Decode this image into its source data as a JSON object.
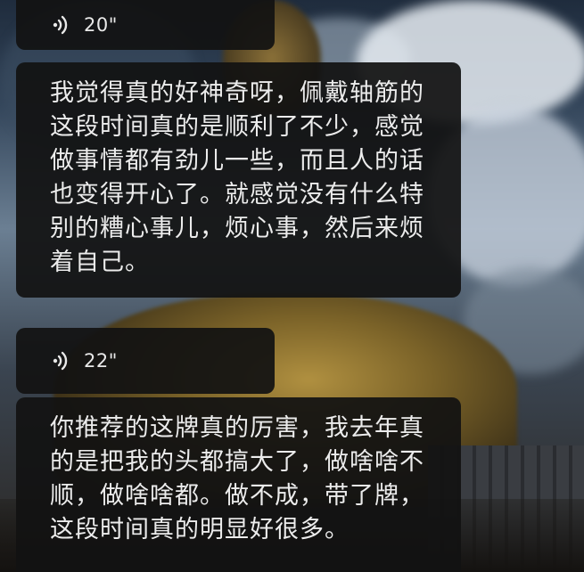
{
  "messages": [
    {
      "voice": {
        "duration": "20\"",
        "icon": "voice-wave-icon"
      },
      "transcript": [
        "我觉得真的好神奇呀，佩戴轴筋的",
        "这段时间真的是顺利了不少，感觉",
        "做事情都有劲儿一些，而且人的话",
        "也变得开心了。就感觉没有什么特",
        "别的糟心事儿，烦心事，然后来烦",
        "着自己。"
      ]
    },
    {
      "voice": {
        "duration": "22\"",
        "icon": "voice-wave-icon"
      },
      "transcript": [
        "你推荐的这牌真的厉害，我去年真",
        "的是把我的头都搞大了，做啥啥不",
        "顺，做啥啥都。做不成，带了牌，",
        "这段时间真的明显好很多。"
      ]
    }
  ],
  "colors": {
    "bubble_bg": "#121212",
    "text": "#ececec"
  }
}
